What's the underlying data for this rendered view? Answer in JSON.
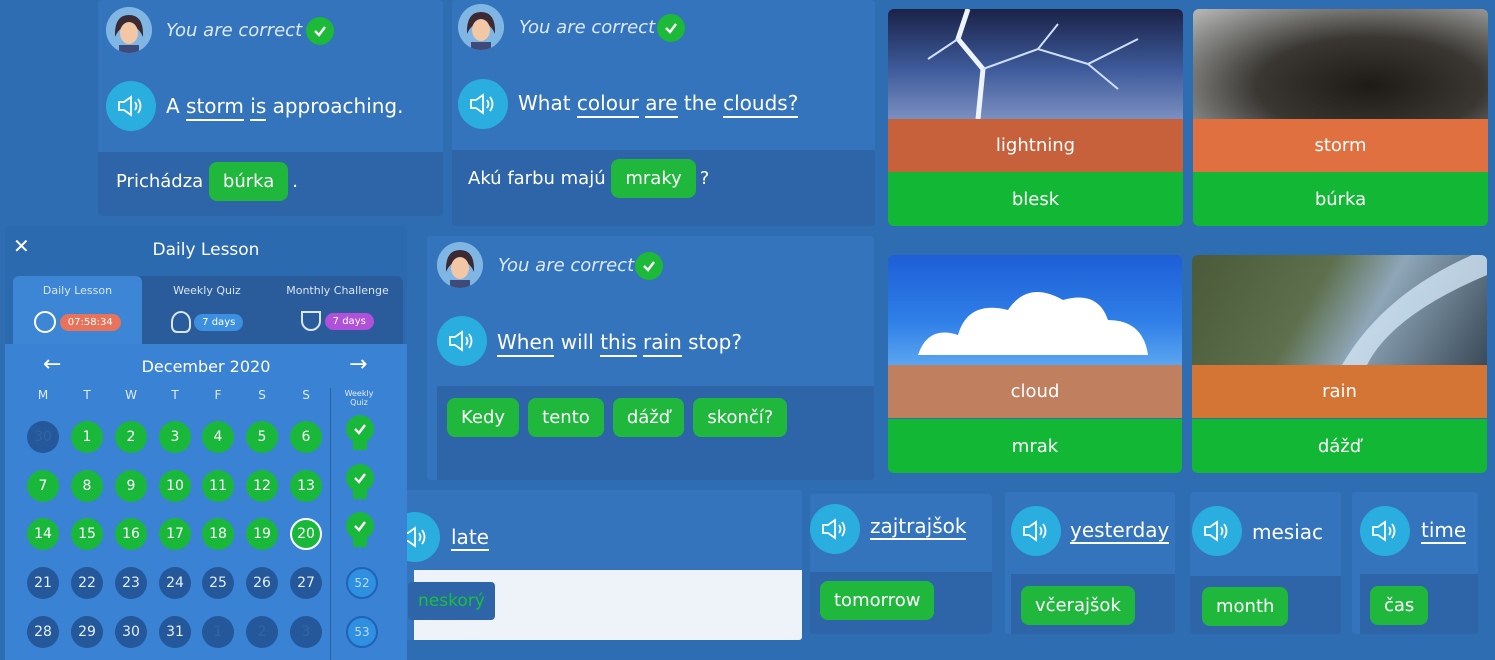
{
  "feedback": {
    "correct_text": "You are correct"
  },
  "exercise1": {
    "sentence": [
      "A",
      "storm",
      "is",
      "approaching."
    ],
    "answer_prefix": "Prichádza",
    "answer_chip": "búrka",
    "answer_suffix": "."
  },
  "exercise2": {
    "sentence": [
      "What",
      "colour",
      "are",
      "the",
      "clouds?"
    ],
    "answer_prefix": "Akú farbu majú",
    "answer_chip": "mraky",
    "answer_suffix": "?"
  },
  "exercise3": {
    "sentence": [
      "When",
      "will",
      "this",
      "rain",
      "stop?"
    ],
    "chips": [
      "Kedy",
      "tento",
      "dážď",
      "skončí?"
    ]
  },
  "picture_cards": [
    {
      "word": "lightning",
      "translation": "blesk",
      "image": "lightning-bolt"
    },
    {
      "word": "storm",
      "translation": "búrka",
      "image": "storm-clouds"
    },
    {
      "word": "cloud",
      "translation": "mrak",
      "image": "white-cloud-blue-sky"
    },
    {
      "word": "rain",
      "translation": "dážď",
      "image": "rain-falling"
    }
  ],
  "vocab_cards": [
    {
      "word": "late",
      "translation": "neskorý"
    },
    {
      "word": "zajtrajšok",
      "translation": "tomorrow"
    },
    {
      "word": "yesterday",
      "translation": "včerajšok"
    },
    {
      "word": "mesiac",
      "translation": "month"
    },
    {
      "word": "time",
      "translation": "čas"
    }
  ],
  "lesson_panel": {
    "title": "Daily Lesson",
    "close_icon": "close-icon",
    "tabs": [
      {
        "label": "Daily Lesson",
        "pill": "07:58:34",
        "icon": "clock-icon",
        "pill_color": "#e8735a"
      },
      {
        "label": "Weekly Quiz",
        "pill": "7 days",
        "icon": "bulb-icon",
        "pill_color": "#3d8fe0"
      },
      {
        "label": "Monthly Challenge",
        "pill": "7 days",
        "icon": "trophy-icon",
        "pill_color": "#b150d8"
      }
    ],
    "month_label": "December 2020",
    "weekdays": [
      "M",
      "T",
      "W",
      "T",
      "F",
      "S",
      "S"
    ],
    "weekly_quiz_label": "Weekly Quiz",
    "weeks": [
      [
        "30",
        "1",
        "2",
        "3",
        "4",
        "5",
        "6"
      ],
      [
        "7",
        "8",
        "9",
        "10",
        "11",
        "12",
        "13"
      ],
      [
        "14",
        "15",
        "16",
        "17",
        "18",
        "19",
        "20"
      ],
      [
        "21",
        "22",
        "23",
        "24",
        "25",
        "26",
        "27"
      ],
      [
        "28",
        "29",
        "30",
        "31",
        "1",
        "2",
        "3"
      ]
    ],
    "week_numbers": [
      "52",
      "53"
    ]
  },
  "colors": {
    "background": "#2f6db3",
    "green": "#1fb83d",
    "speaker": "#2aaee0",
    "band": "#c7603a"
  }
}
